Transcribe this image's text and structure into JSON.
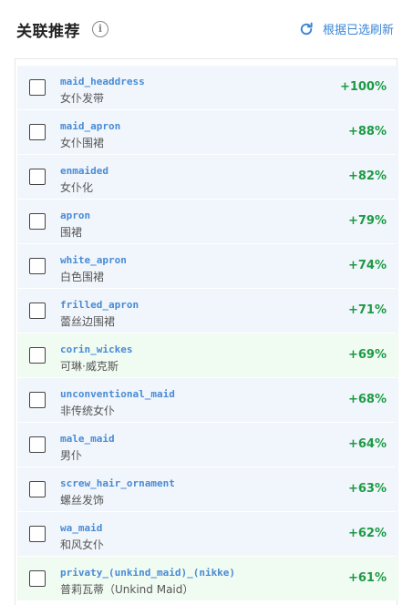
{
  "header": {
    "title": "关联推荐",
    "info_icon": "info-icon",
    "refresh_label": "根据已选刷新",
    "refresh_icon": "refresh-icon"
  },
  "colors": {
    "accent": "#3a86d6",
    "score": "#1d9a44",
    "tag": "#4a8bd4"
  },
  "items": [
    {
      "tag": "maid_headdress",
      "translation": "女仆发带",
      "score": "+100%",
      "highlight": "blue"
    },
    {
      "tag": "maid_apron",
      "translation": "女仆围裙",
      "score": "+88%",
      "highlight": "blue"
    },
    {
      "tag": "enmaided",
      "translation": "女仆化",
      "score": "+82%",
      "highlight": "blue"
    },
    {
      "tag": "apron",
      "translation": "围裙",
      "score": "+79%",
      "highlight": "blue"
    },
    {
      "tag": "white_apron",
      "translation": "白色围裙",
      "score": "+74%",
      "highlight": "blue"
    },
    {
      "tag": "frilled_apron",
      "translation": "蕾丝边围裙",
      "score": "+71%",
      "highlight": "blue"
    },
    {
      "tag": "corin_wickes",
      "translation": "可琳·威克斯",
      "score": "+69%",
      "highlight": "green"
    },
    {
      "tag": "unconventional_maid",
      "translation": "非传统女仆",
      "score": "+68%",
      "highlight": "blue"
    },
    {
      "tag": "male_maid",
      "translation": "男仆",
      "score": "+64%",
      "highlight": "blue"
    },
    {
      "tag": "screw_hair_ornament",
      "translation": "螺丝发饰",
      "score": "+63%",
      "highlight": "blue"
    },
    {
      "tag": "wa_maid",
      "translation": "和风女仆",
      "score": "+62%",
      "highlight": "blue"
    },
    {
      "tag": "privaty_(unkind_maid)_(nikke)",
      "translation": "普莉瓦蒂（Unkind Maid）",
      "score": "+61%",
      "highlight": "green"
    }
  ]
}
